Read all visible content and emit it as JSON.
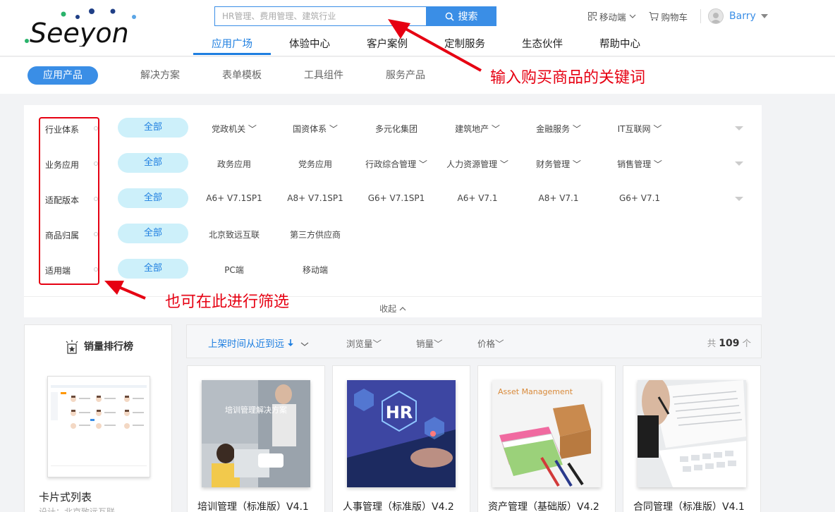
{
  "header": {
    "brand": "Seeyon",
    "search": {
      "placeholder": "HR管理、费用管理、建筑行业",
      "button_label": "搜索"
    },
    "nav": [
      "应用广场",
      "体验中心",
      "客户案例",
      "定制服务",
      "生态伙伴",
      "帮助中心"
    ],
    "mobile_label": "移动端",
    "cart_label": "购物车",
    "username": "Barry"
  },
  "subnav": [
    "应用产品",
    "解决方案",
    "表单模板",
    "工具组件",
    "服务产品"
  ],
  "filters": {
    "all_label": "全部",
    "rows": [
      {
        "label": "行业体系",
        "options": [
          "党政机关",
          "国资体系",
          "多元化集团",
          "建筑地产",
          "金融服务",
          "IT互联网"
        ]
      },
      {
        "label": "业务应用",
        "options": [
          "政务应用",
          "党务应用",
          "行政综合管理",
          "人力资源管理",
          "财务管理",
          "销售管理"
        ]
      },
      {
        "label": "适配版本",
        "options": [
          "A6+ V7.1SP1",
          "A8+ V7.1SP1",
          "G6+ V7.1SP1",
          "A6+ V7.1",
          "A8+ V7.1",
          "G6+ V7.1"
        ]
      },
      {
        "label": "商品归属",
        "options": [
          "北京致远互联",
          "第三方供应商"
        ]
      },
      {
        "label": "适用端",
        "options": [
          "PC端",
          "移动端"
        ]
      }
    ],
    "collapse_label": "收起"
  },
  "annotations": {
    "search_hint": "输入购买商品的关键词",
    "filter_hint": "也可在此进行筛选"
  },
  "ranking": {
    "title": "销量排行榜",
    "item_name": "卡片式列表",
    "item_sub": "设计：北京致远互联"
  },
  "sortbar": {
    "active_sort": "上架时间从近到远",
    "sorts": [
      "浏览量",
      "销量",
      "价格"
    ],
    "count_prefix": "共",
    "count": "109",
    "count_suffix": "个"
  },
  "products": [
    {
      "name": "培训管理（标准版）V4.1",
      "image_text": "培训管理解决方案"
    },
    {
      "name": "人事管理（标准版）V4.2",
      "image_text": "HR"
    },
    {
      "name": "资产管理（基础版）V4.2",
      "image_text": "Asset Management"
    },
    {
      "name": "合同管理（标准版）V4.1",
      "image_text": ""
    }
  ],
  "colors": {
    "accent": "#3a8ee6",
    "annotation_red": "#e60012",
    "filter_pill": "#cdf0fa"
  }
}
